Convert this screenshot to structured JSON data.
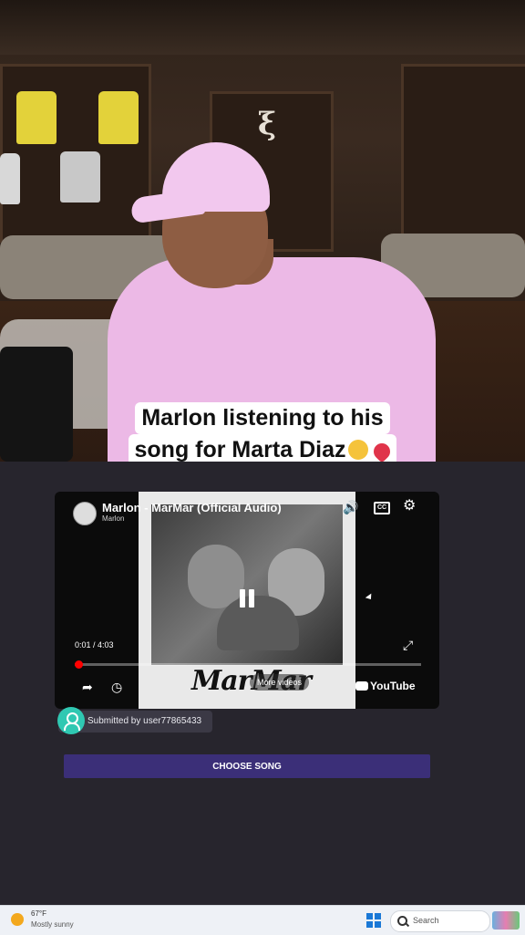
{
  "caption": {
    "line1": "Marlon listening to his",
    "line2": "song for Marta Diaz"
  },
  "player": {
    "title": "Marlon - MarMar (Official Audio)",
    "channel": "Marlon",
    "current_time": "0:01 / 4:03",
    "progress_fraction": 0.0041,
    "more_videos": "More videos",
    "youtube_logo": "YouTube",
    "cover_text": "MarMar",
    "cc_label": "CC",
    "accent_color": "#ff0000"
  },
  "submission": {
    "text": "Submitted by user77865433"
  },
  "choose_button": {
    "label": "CHOOSE SONG"
  },
  "taskbar": {
    "temperature": "67°F",
    "condition": "Mostly sunny",
    "search_placeholder": "Search"
  },
  "icons": {
    "volume": "volume-icon",
    "cc": "closed-captions-icon",
    "settings": "gear-icon",
    "share": "share-icon",
    "watch_later": "clock-icon",
    "fullscreen": "fullscreen-icon",
    "pause": "pause-icon"
  }
}
